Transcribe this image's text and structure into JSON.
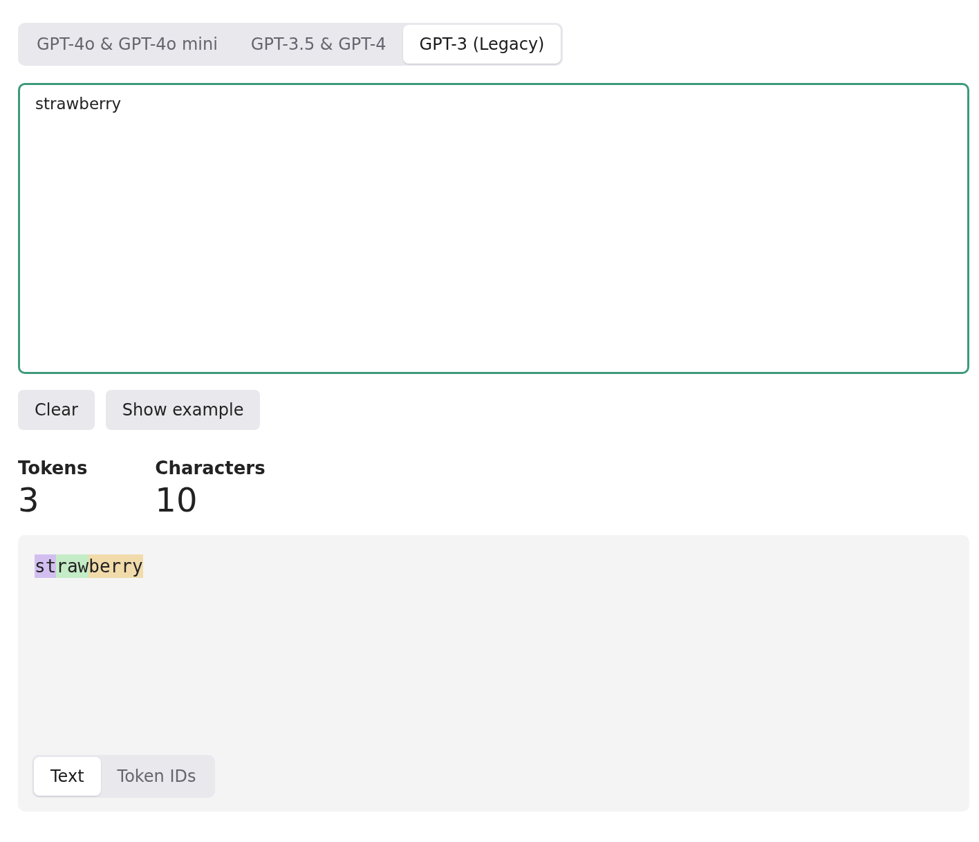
{
  "model_tabs": [
    {
      "label": "GPT-4o & GPT-4o mini",
      "selected": false
    },
    {
      "label": "GPT-3.5 & GPT-4",
      "selected": false
    },
    {
      "label": "GPT-3 (Legacy)",
      "selected": true
    }
  ],
  "input": {
    "value": "strawberry"
  },
  "buttons": [
    "Clear",
    "Show example"
  ],
  "stats": [
    {
      "label": "Tokens",
      "value": "3"
    },
    {
      "label": "Characters",
      "value": "10"
    }
  ],
  "tokens": [
    {
      "text": "st",
      "color": "#d2bff0"
    },
    {
      "text": "raw",
      "color": "#c4ecc6"
    },
    {
      "text": "berry",
      "color": "#f1dbab"
    }
  ],
  "view_tabs": [
    {
      "label": "Text",
      "selected": true
    },
    {
      "label": "Token IDs",
      "selected": false
    }
  ]
}
